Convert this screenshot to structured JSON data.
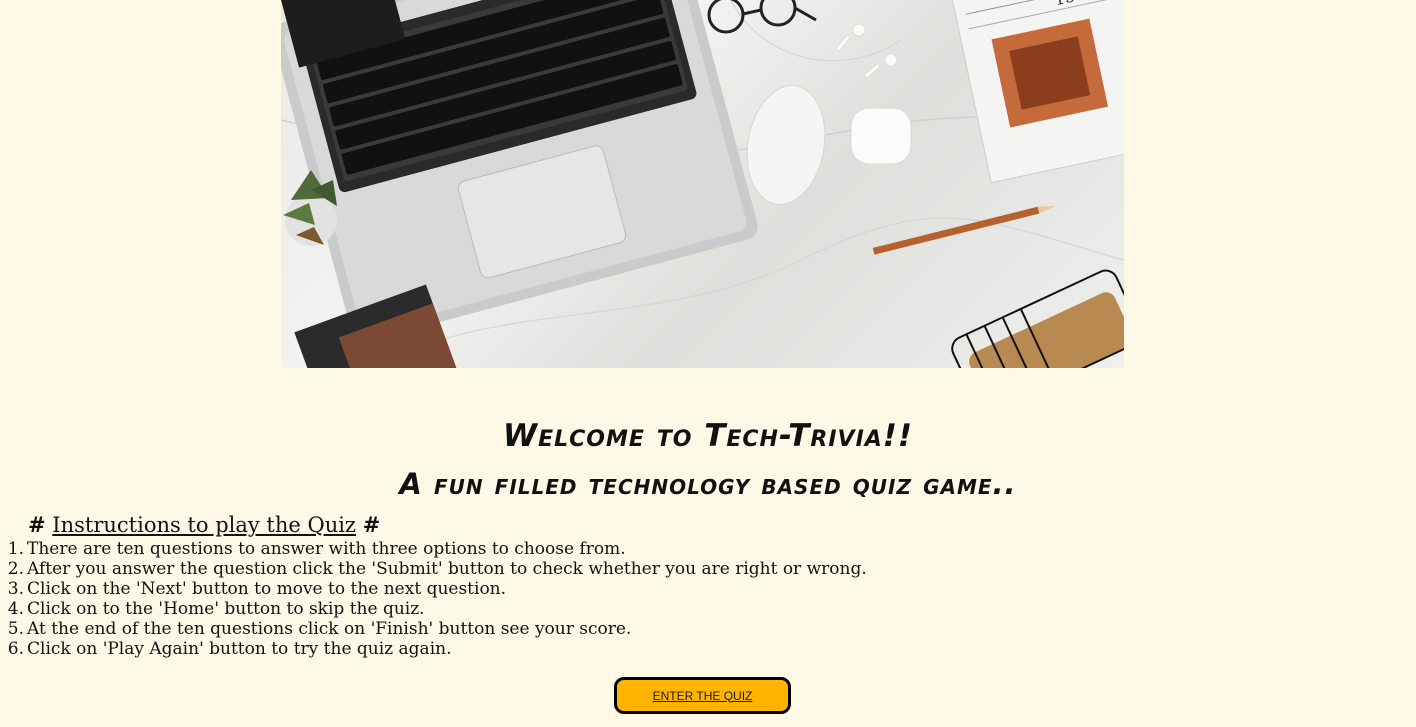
{
  "hero": {
    "alt": "Laptop on a marble desk with glasses, earbuds, mouse, pencil and newspaper"
  },
  "welcome": {
    "line1": "Welcome to Tech-Trivia!!",
    "line2": "A fun filled technology based quiz game.."
  },
  "instructions": {
    "hash_left": "#",
    "title": "Instructions to play the Quiz",
    "hash_right": "#",
    "steps": [
      {
        "num": "1.",
        "text": "There are ten questions to answer with three options to choose from."
      },
      {
        "num": "2.",
        "text": "After you answer the question click the 'Submit' button to check whether you are right or wrong."
      },
      {
        "num": "3.",
        "text": "Click on the 'Next' button to move to the next question."
      },
      {
        "num": "4.",
        "text": "Click on to the 'Home' button to skip the quiz."
      },
      {
        "num": "5.",
        "text": "At the end of the ten questions click on 'Finish' button see your score."
      },
      {
        "num": "6.",
        "text": "Click on 'Play Again' button to try the quiz again."
      }
    ]
  },
  "enter_button": {
    "label": "ENTER THE QUIZ",
    "color": "#ffb400"
  },
  "colors": {
    "background": "#fef8e7",
    "text": "#111111"
  }
}
